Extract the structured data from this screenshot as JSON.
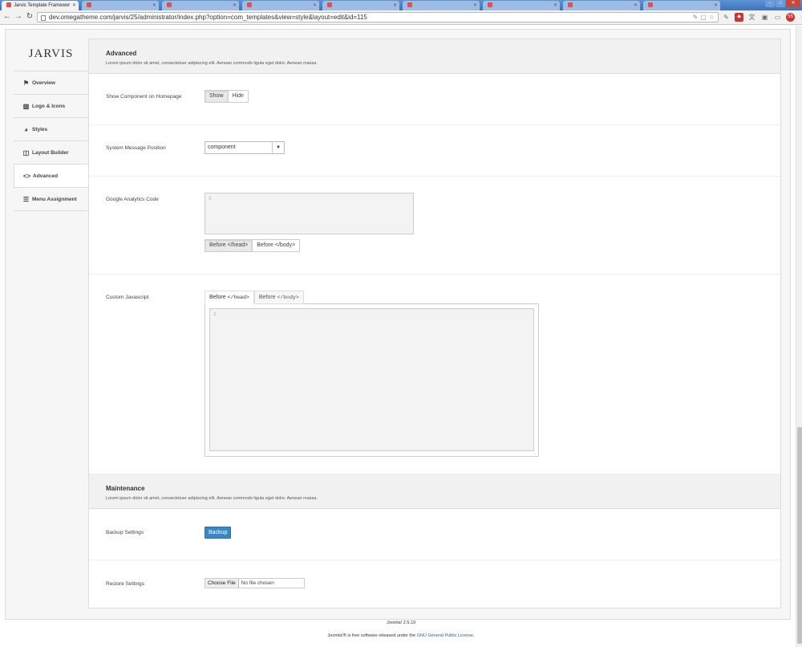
{
  "browser": {
    "tabs": [
      {
        "title": "Jarvis Template Framewor",
        "active": true
      },
      {
        "title": "",
        "active": false
      },
      {
        "title": "",
        "active": false
      },
      {
        "title": "",
        "active": false
      },
      {
        "title": "",
        "active": false
      },
      {
        "title": "",
        "active": false
      },
      {
        "title": "",
        "active": false
      },
      {
        "title": "",
        "active": false
      },
      {
        "title": "",
        "active": false
      },
      {
        "title": "",
        "active": false
      }
    ],
    "url": "dev.omegatheme.com/jarvis/25/administrator/index.php?option=com_templates&view=style&layout=edit&id=115",
    "ext_badge": "55"
  },
  "sidebar": {
    "logo": "JARVIS",
    "items": [
      {
        "label": "Overview",
        "icon": "flag-icon"
      },
      {
        "label": "Logo & Icons",
        "icon": "image-icon"
      },
      {
        "label": "Styles",
        "icon": "palette-icon"
      },
      {
        "label": "Layout Builder",
        "icon": "layout-icon"
      },
      {
        "label": "Advanced",
        "icon": "code-icon"
      },
      {
        "label": "Menu Assignment",
        "icon": "list-icon"
      }
    ]
  },
  "advanced": {
    "title": "Advanced",
    "desc": "Lorem ipsum dolor sit amet, consectetuer adipiscing elit. Aenean commodo ligula eget dolor. Aenean massa.",
    "show_component_label": "Show Component on Homepage",
    "show_label": "Show",
    "hide_label": "Hide",
    "system_message_label": "System Message Position",
    "system_message_value": "component",
    "ga_label": "Google Analytics Code",
    "ga_gutter": "1",
    "before_head": "Before </head>",
    "before_body": "Before </body>",
    "custom_js_label": "Custom Javascript",
    "tab_before": "Before",
    "tab_head_code": "</head>",
    "tab_body_code": "</body>",
    "js_gutter": "1"
  },
  "maintenance": {
    "title": "Maintenance",
    "desc": "Lorem ipsum dolor sit amet, consectetuer adipiscing elit. Aenean commodo ligula eget dolor. Aenean massa.",
    "backup_label": "Backup Settings",
    "backup_button": "Backup",
    "restore_label": "Restore Settings",
    "choose_file": "Choose File",
    "no_file": "No file chosen"
  },
  "footer": {
    "version": "Joomla! 2.5.19",
    "license_pre": "Joomla!® is free software released under the ",
    "license_link": "GNU General Public License",
    "license_post": "."
  }
}
